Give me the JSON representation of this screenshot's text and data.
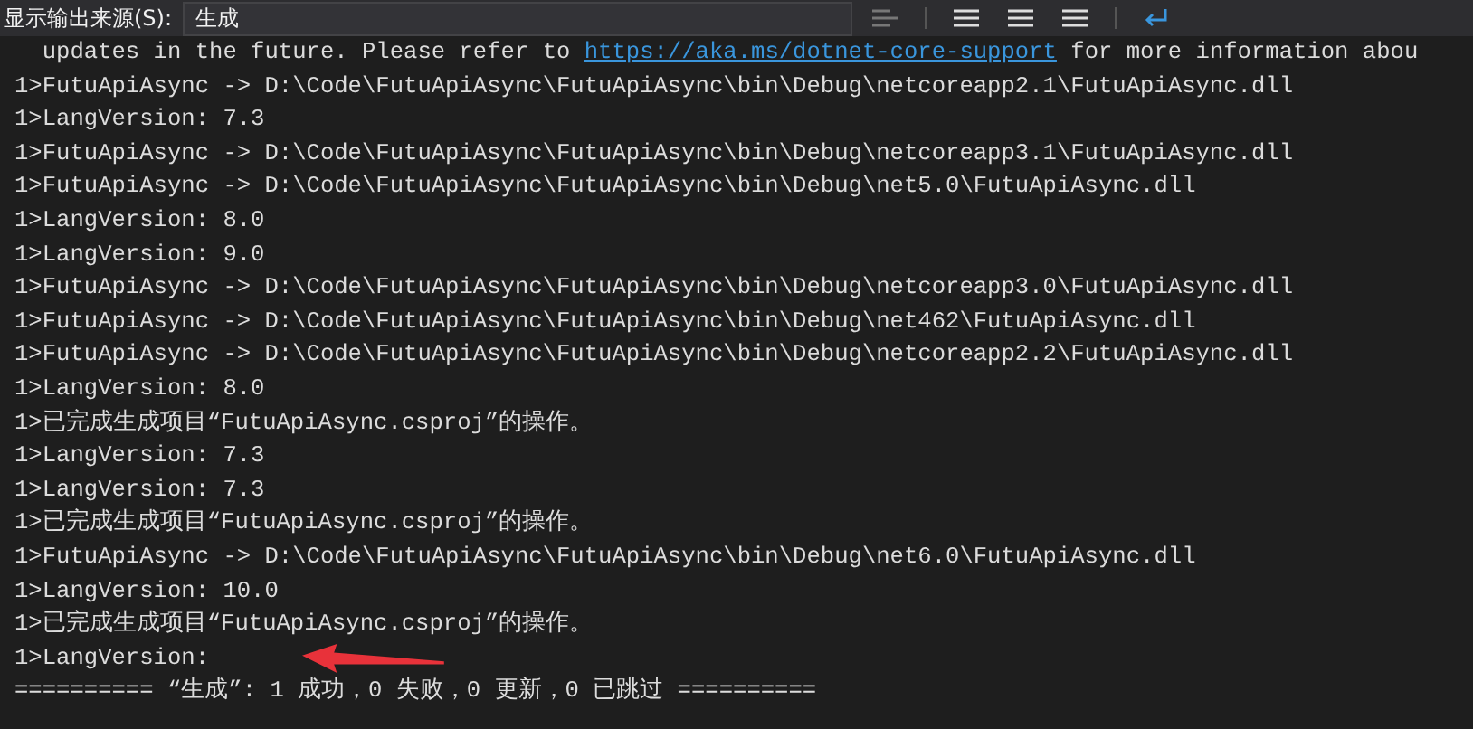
{
  "toolbar": {
    "source_label": "显示输出来源(S):",
    "source_value": "生成"
  },
  "output": {
    "notice": {
      "before": "  updates in the future. Please refer to ",
      "link": "https://aka.ms/dotnet-core-support",
      "after": " for more information abou"
    },
    "lines": [
      "1>FutuApiAsync -> D:\\Code\\FutuApiAsync\\FutuApiAsync\\bin\\Debug\\netcoreapp2.1\\FutuApiAsync.dll",
      "1>LangVersion: 7.3",
      "1>FutuApiAsync -> D:\\Code\\FutuApiAsync\\FutuApiAsync\\bin\\Debug\\netcoreapp3.1\\FutuApiAsync.dll",
      "1>FutuApiAsync -> D:\\Code\\FutuApiAsync\\FutuApiAsync\\bin\\Debug\\net5.0\\FutuApiAsync.dll",
      "1>LangVersion: 8.0",
      "1>LangVersion: 9.0",
      "1>FutuApiAsync -> D:\\Code\\FutuApiAsync\\FutuApiAsync\\bin\\Debug\\netcoreapp3.0\\FutuApiAsync.dll",
      "1>FutuApiAsync -> D:\\Code\\FutuApiAsync\\FutuApiAsync\\bin\\Debug\\net462\\FutuApiAsync.dll",
      "1>FutuApiAsync -> D:\\Code\\FutuApiAsync\\FutuApiAsync\\bin\\Debug\\netcoreapp2.2\\FutuApiAsync.dll",
      "1>LangVersion: 8.0",
      "1>已完成生成项目“FutuApiAsync.csproj”的操作。",
      "1>LangVersion: 7.3",
      "1>LangVersion: 7.3",
      "1>已完成生成项目“FutuApiAsync.csproj”的操作。",
      "1>FutuApiAsync -> D:\\Code\\FutuApiAsync\\FutuApiAsync\\bin\\Debug\\net6.0\\FutuApiAsync.dll",
      "1>LangVersion: 10.0",
      "1>已完成生成项目“FutuApiAsync.csproj”的操作。",
      "1>LangVersion:",
      "========== “生成”: 1 成功，0 失败，0 更新，0 已跳过 =========="
    ]
  }
}
